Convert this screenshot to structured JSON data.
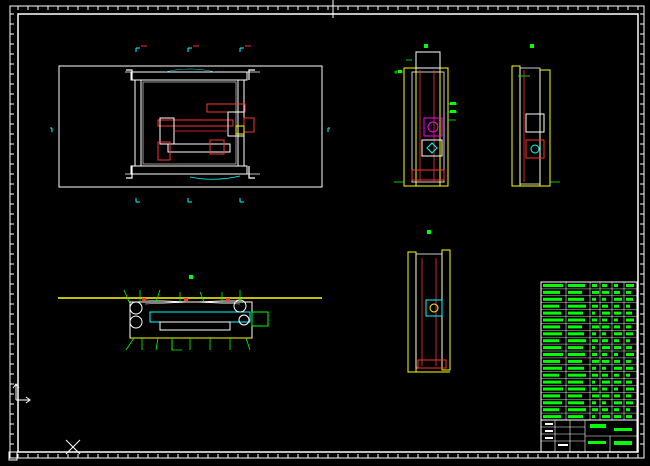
{
  "colors": {
    "background": "#000000",
    "border": "#ffffff",
    "yellow": "#ffff00",
    "green": "#00ff00",
    "cyan": "#00ffff",
    "red": "#ff0000",
    "magenta": "#ff00ff",
    "white": "#ffffff"
  },
  "icons": {
    "ucs": "ucs-axis-icon",
    "crosshair": "crosshair-icon"
  }
}
